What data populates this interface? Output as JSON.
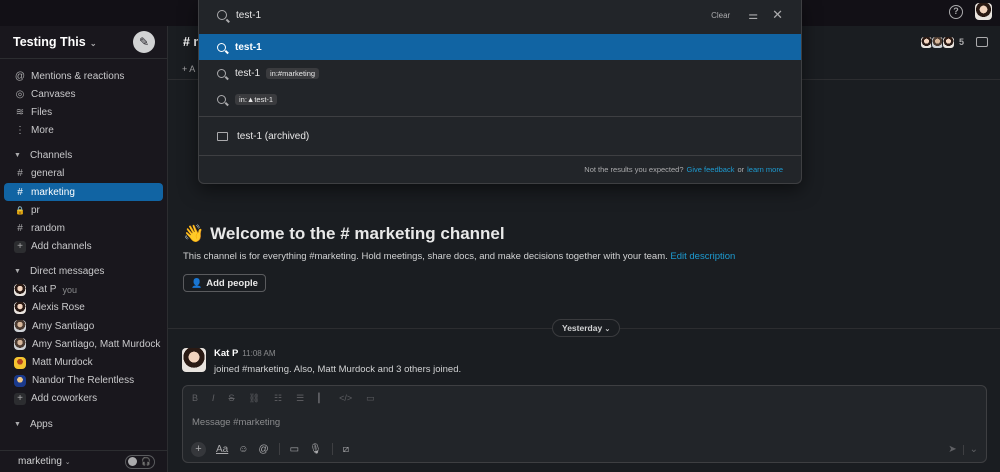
{
  "workspace": {
    "name": "Testing This"
  },
  "sidebar": {
    "top_items": [
      {
        "icon": "at-icon",
        "glyph": "@",
        "label": "Mentions & reactions"
      },
      {
        "icon": "canvas-icon",
        "glyph": "◎",
        "label": "Canvases"
      },
      {
        "icon": "files-icon",
        "glyph": "≋",
        "label": "Files"
      },
      {
        "icon": "more-icon",
        "glyph": "⋮",
        "label": "More"
      }
    ],
    "channels_label": "Channels",
    "channels": [
      {
        "glyph": "#",
        "label": "general"
      },
      {
        "glyph": "#",
        "label": "marketing",
        "active": true
      },
      {
        "glyph": "🔒",
        "label": "pr"
      },
      {
        "glyph": "#",
        "label": "random"
      }
    ],
    "add_channels": "Add channels",
    "dm_label": "Direct messages",
    "dms": [
      {
        "label": "Kat P",
        "you": "you",
        "avatar": "lady"
      },
      {
        "label": "Alexis Rose",
        "avatar": "lady"
      },
      {
        "label": "Amy Santiago",
        "avatar": "man"
      },
      {
        "label": "Amy Santiago, Matt Murdock",
        "avatar": "man"
      },
      {
        "label": "Matt Murdock",
        "avatar": "yellow"
      },
      {
        "label": "Nandor The Relentless",
        "avatar": "blue"
      }
    ],
    "add_coworkers": "Add coworkers",
    "apps_label": "Apps",
    "footer_channel": "marketing"
  },
  "channel": {
    "header": "# m",
    "member_count": "5",
    "bookmark_add": "+ A"
  },
  "search": {
    "query": "test-1",
    "clear_label": "Clear",
    "suggestions": [
      {
        "text": "test-1",
        "chip": "",
        "selected": true
      },
      {
        "text": "test-1",
        "chip": "in:#marketing",
        "selected": false
      }
    ],
    "scope_chip": "in:▲test-1",
    "archived": "test-1 (archived)",
    "footer_text": "Not the results you expected?",
    "feedback_link": "Give feedback",
    "or": "or",
    "learn_link": "learn more"
  },
  "welcome": {
    "emoji": "👋",
    "title": "Welcome to the # marketing channel",
    "description": "This channel is for everything #marketing. Hold meetings, share docs, and make decisions together with your team.",
    "edit_link": "Edit description",
    "add_people": "Add people"
  },
  "date_divider": "Yesterday",
  "message": {
    "author": "Kat P",
    "time": "11:08 AM",
    "body": "joined #marketing. Also, Matt Murdock and 3 others joined."
  },
  "composer": {
    "placeholder": "Message #marketing"
  }
}
